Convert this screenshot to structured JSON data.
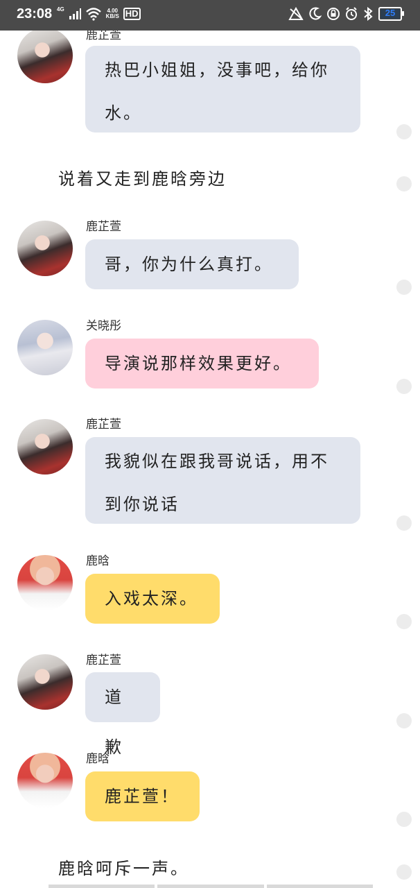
{
  "status_bar": {
    "time": "23:08",
    "network": "4G",
    "speed_value": "4.00",
    "speed_unit": "KB/S",
    "hd": "HD",
    "battery": "25"
  },
  "messages": [
    {
      "type": "bubble",
      "speaker": "鹿芷萱",
      "avatar": "lu-zhixuan-avatar",
      "color": "grey",
      "lines": [
        "热巴小姐姐，没事吧，给你",
        "水。"
      ]
    },
    {
      "type": "narration",
      "text": "说着又走到鹿晗旁边"
    },
    {
      "type": "bubble",
      "speaker": "鹿芷萱",
      "avatar": "lu-zhixuan-avatar",
      "color": "grey",
      "lines": [
        "哥，你为什么真打。"
      ]
    },
    {
      "type": "bubble",
      "speaker": "关晓彤",
      "avatar": "guan-xiaotong-avatar",
      "color": "pink",
      "lines": [
        "导演说那样效果更好。"
      ]
    },
    {
      "type": "bubble",
      "speaker": "鹿芷萱",
      "avatar": "lu-zhixuan-avatar",
      "color": "grey",
      "lines": [
        "我貌似在跟我哥说话，用不",
        "到你说话"
      ]
    },
    {
      "type": "bubble",
      "speaker": "鹿晗",
      "avatar": "lu-han-avatar",
      "color": "yellow",
      "lines": [
        "入戏太深。"
      ]
    },
    {
      "type": "bubble",
      "speaker": "鹿芷萱",
      "avatar": "lu-zhixuan-avatar",
      "color": "grey",
      "lines": [
        "道歉"
      ]
    },
    {
      "type": "bubble",
      "speaker": "鹿晗",
      "avatar": "lu-han-avatar",
      "color": "yellow",
      "lines": [
        "鹿芷萱！"
      ]
    },
    {
      "type": "narration",
      "text": "鹿晗呵斥一声。"
    }
  ]
}
